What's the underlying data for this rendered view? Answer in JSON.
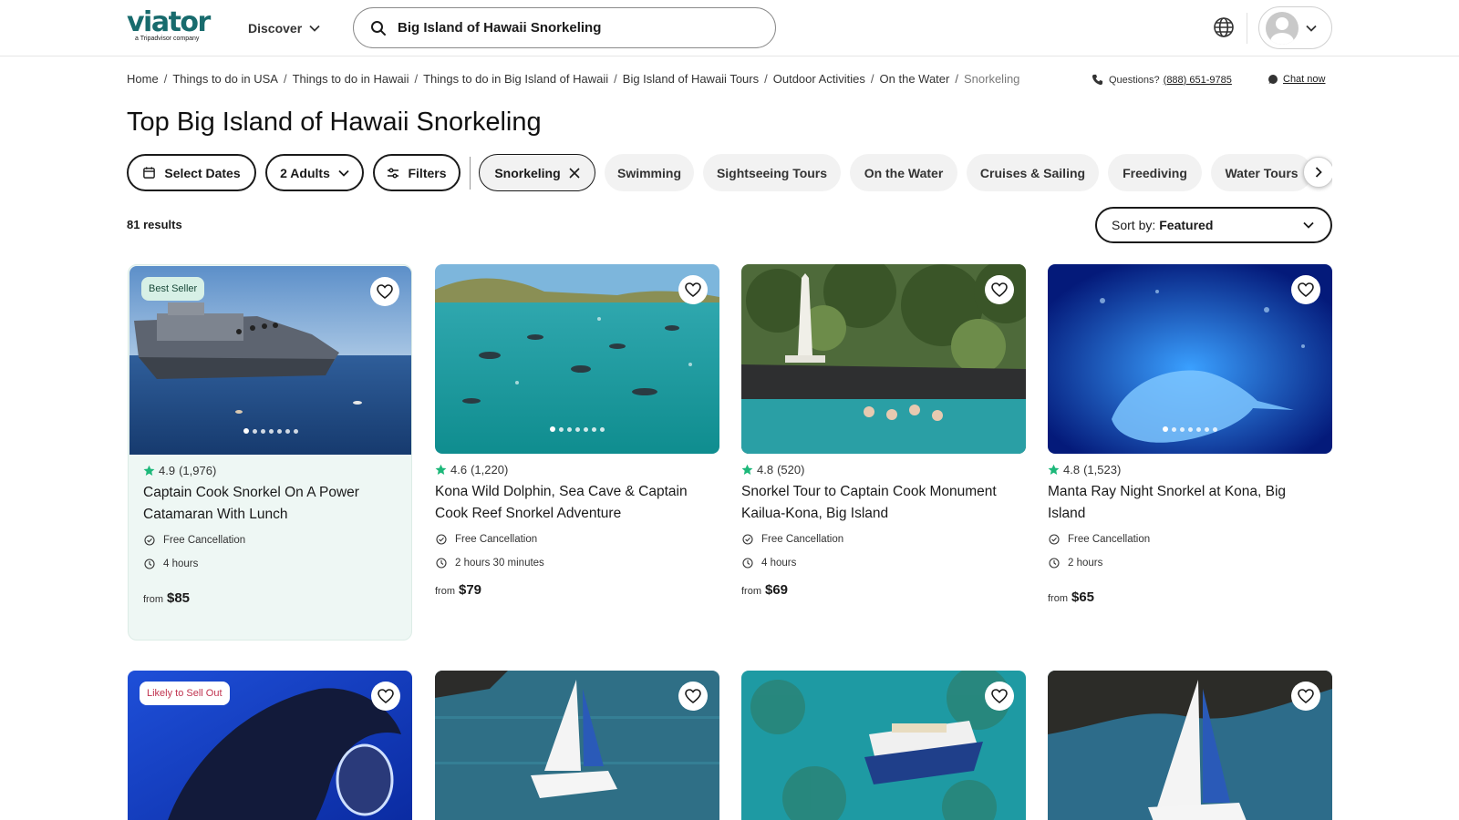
{
  "header": {
    "logo_text": "viator",
    "logo_sub": "a Tripadvisor company",
    "discover_label": "Discover",
    "search_value": "Big Island of Hawaii Snorkeling",
    "icons": [
      "search-icon",
      "globe-icon",
      "avatar",
      "chevron-down-icon"
    ]
  },
  "breadcrumbs": [
    "Home",
    "Things to do in USA",
    "Things to do in Hawaii",
    "Things to do in Big Island of Hawaii",
    "Big Island of Hawaii Tours",
    "Outdoor Activities",
    "On the Water",
    "Snorkeling"
  ],
  "support": {
    "questions_label": "Questions?",
    "phone": "(888) 651-9785",
    "chat_label": "Chat now"
  },
  "page_title": "Top Big Island of Hawaii Snorkeling",
  "filters": {
    "dates_label": "Select Dates",
    "travelers_label": "2 Adults",
    "filters_label": "Filters",
    "chips": [
      "Snorkeling",
      "Swimming",
      "Sightseeing Tours",
      "On the Water",
      "Cruises & Sailing",
      "Freediving",
      "Water Tours"
    ]
  },
  "results": {
    "count_label": "81 results",
    "sort_prefix": "Sort by:",
    "sort_value": "Featured"
  },
  "cards": [
    {
      "badge": "Best Seller",
      "rating": "4.9",
      "reviews": "(1,976)",
      "title": "Captain Cook Snorkel On A Power Catamaran With Lunch",
      "cancellation": "Free Cancellation",
      "duration": "4 hours",
      "from": "from",
      "price": "$85"
    },
    {
      "badge": "",
      "rating": "4.6",
      "reviews": "(1,220)",
      "title": "Kona Wild Dolphin, Sea Cave & Captain Cook Reef Snorkel Adventure",
      "cancellation": "Free Cancellation",
      "duration": "2 hours 30 minutes",
      "from": "from",
      "price": "$79"
    },
    {
      "badge": "",
      "rating": "4.8",
      "reviews": "(520)",
      "title": "Snorkel Tour to Captain Cook Monument Kailua-Kona, Big Island",
      "cancellation": "Free Cancellation",
      "duration": "4 hours",
      "from": "from",
      "price": "$69"
    },
    {
      "badge": "",
      "rating": "4.8",
      "reviews": "(1,523)",
      "title": "Manta Ray Night Snorkel at Kona, Big Island",
      "cancellation": "Free Cancellation",
      "duration": "2 hours",
      "from": "from",
      "price": "$65"
    },
    {
      "badge": "Likely to Sell Out"
    }
  ],
  "colors": {
    "brand": "#186b6d",
    "star": "#1db87a",
    "featured_bg": "#eef7f4",
    "sell_out": "#c0334f"
  }
}
